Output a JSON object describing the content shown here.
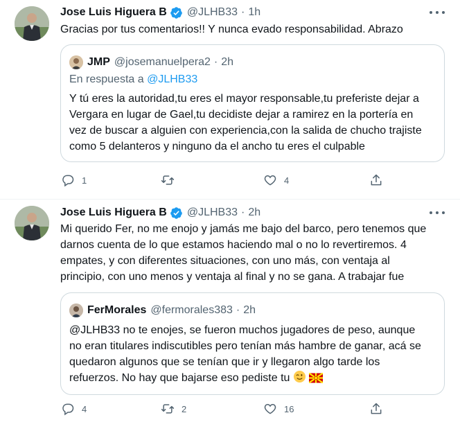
{
  "tweets": [
    {
      "author_name": "Jose Luis Higuera B",
      "author_handle": "@JLHB33",
      "separator": "·",
      "time": "1h",
      "text": "Gracias por tus comentarios!! Y nunca evado responsabilidad. Abrazo",
      "quote": {
        "author_name": "JMP",
        "author_handle": "@josemanuelpera2",
        "separator": "·",
        "time": "2h",
        "reply_prefix": "En respuesta a ",
        "reply_mention": "@JLHB33",
        "text_lines": [
          "Y tú eres la autoridad,tu eres el mayor responsable,tu preferiste dejar a",
          "Vergara en lugar de Gael,tu decidiste dejar a ramirez  en la portería en",
          "vez de buscar a alguien con experiencia,con la salida de chucho trajiste",
          "como 5 delanteros y ninguno da el ancho tu eres el culpable"
        ]
      },
      "actions": {
        "replies": "1",
        "retweets": "",
        "likes": "4"
      }
    },
    {
      "author_name": "Jose Luis Higuera B",
      "author_handle": "@JLHB33",
      "separator": "·",
      "time": "2h",
      "text_lines": [
        "Mi querido Fer, no me enojo y jamás me bajo del barco, pero tenemos que",
        "darnos cuenta de lo que estamos haciendo mal o no lo revertiremos. 4",
        "empates, y con diferentes situaciones, con uno más, con ventaja al",
        "principio, con uno menos y ventaja al final y no se gana. A trabajar fue"
      ],
      "quote": {
        "author_name": "FerMorales",
        "author_handle": "@fermorales383",
        "separator": "·",
        "time": "2h",
        "text_lines": [
          "@JLHB33 no te enojes, se fueron muchos jugadores de peso, aunque",
          "no eran titulares indiscutibles pero tenían más hambre de ganar, acá se",
          "quedaron algunos que se tenían que ir y llegaron algo tarde los",
          "refuerzos. No hay que bajarse eso pediste tu"
        ],
        "emojis": [
          "winking-face-emoji",
          "north-macedonia-flag-emoji"
        ]
      },
      "actions": {
        "replies": "4",
        "retweets": "2",
        "likes": "16"
      }
    }
  ],
  "icons": {
    "verified": "verified-badge-icon",
    "more": "more-icon",
    "reply": "reply-icon",
    "retweet": "retweet-icon",
    "like": "like-icon",
    "share": "share-icon"
  },
  "colors": {
    "text": "#0f1419",
    "secondary": "#536471",
    "accent": "#1d9bf0",
    "border": "#cfd9de"
  }
}
